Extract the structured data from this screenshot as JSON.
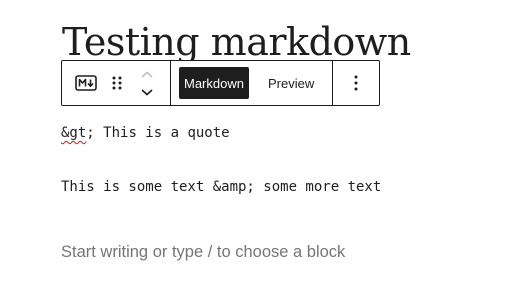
{
  "post": {
    "title": "Testing markdown"
  },
  "toolbar": {
    "block_icon": "markdown-icon",
    "drag_icon": "drag-handle-icon",
    "move_up_icon": "chevron-up-icon",
    "move_down_icon": "chevron-down-icon",
    "tabs": [
      {
        "label": "Markdown",
        "active": true
      },
      {
        "label": "Preview",
        "active": false
      }
    ],
    "more_icon": "vertical-ellipsis-icon"
  },
  "content": {
    "line1_misspelled": "&gt",
    "line1_rest": "; This is a quote",
    "line2": "This is some text &amp; some more text"
  },
  "inserter": {
    "placeholder": "Start writing or type / to choose a block"
  },
  "colors": {
    "text": "#1e1e1e",
    "toolbar_border": "#1e1e1e",
    "active_tab_bg": "#1e1e1e",
    "active_tab_text": "#ffffff",
    "placeholder": "#757575",
    "spellcheck": "#cc1818"
  }
}
